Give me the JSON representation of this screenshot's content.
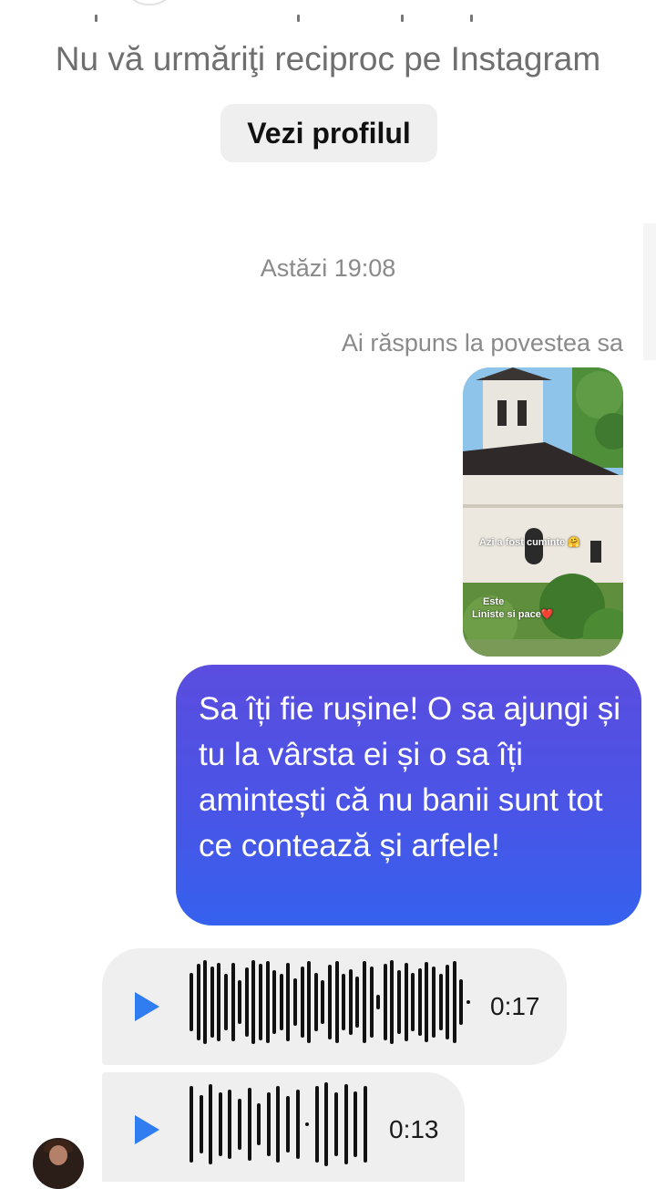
{
  "header": {
    "mutual_follow_text": "Nu vă urmăriţi reciproc pe Instagram",
    "view_profile_button": "Vezi profilul"
  },
  "conversation": {
    "timestamp": "Astăzi 19:08",
    "story_reply": {
      "label": "Ai răspuns la povestea sa",
      "story_caption_1": "Azi a fost cuminte 🤗",
      "story_caption_2": "Este",
      "story_caption_3": "Liniste si pace❤️"
    },
    "sent_message": "Sa îți fie rușine! O sa ajungi și tu la vârsta ei și o sa îți amintești că nu banii sunt tot ce contează și arfele!",
    "voice_messages": [
      {
        "duration": "0:17"
      },
      {
        "duration": "0:13"
      }
    ]
  },
  "colors": {
    "sent_bubble_top": "#5a4ddf",
    "sent_bubble_bottom": "#3561ee",
    "play_icon": "#2f7df0",
    "received_bubble": "#efefef"
  }
}
